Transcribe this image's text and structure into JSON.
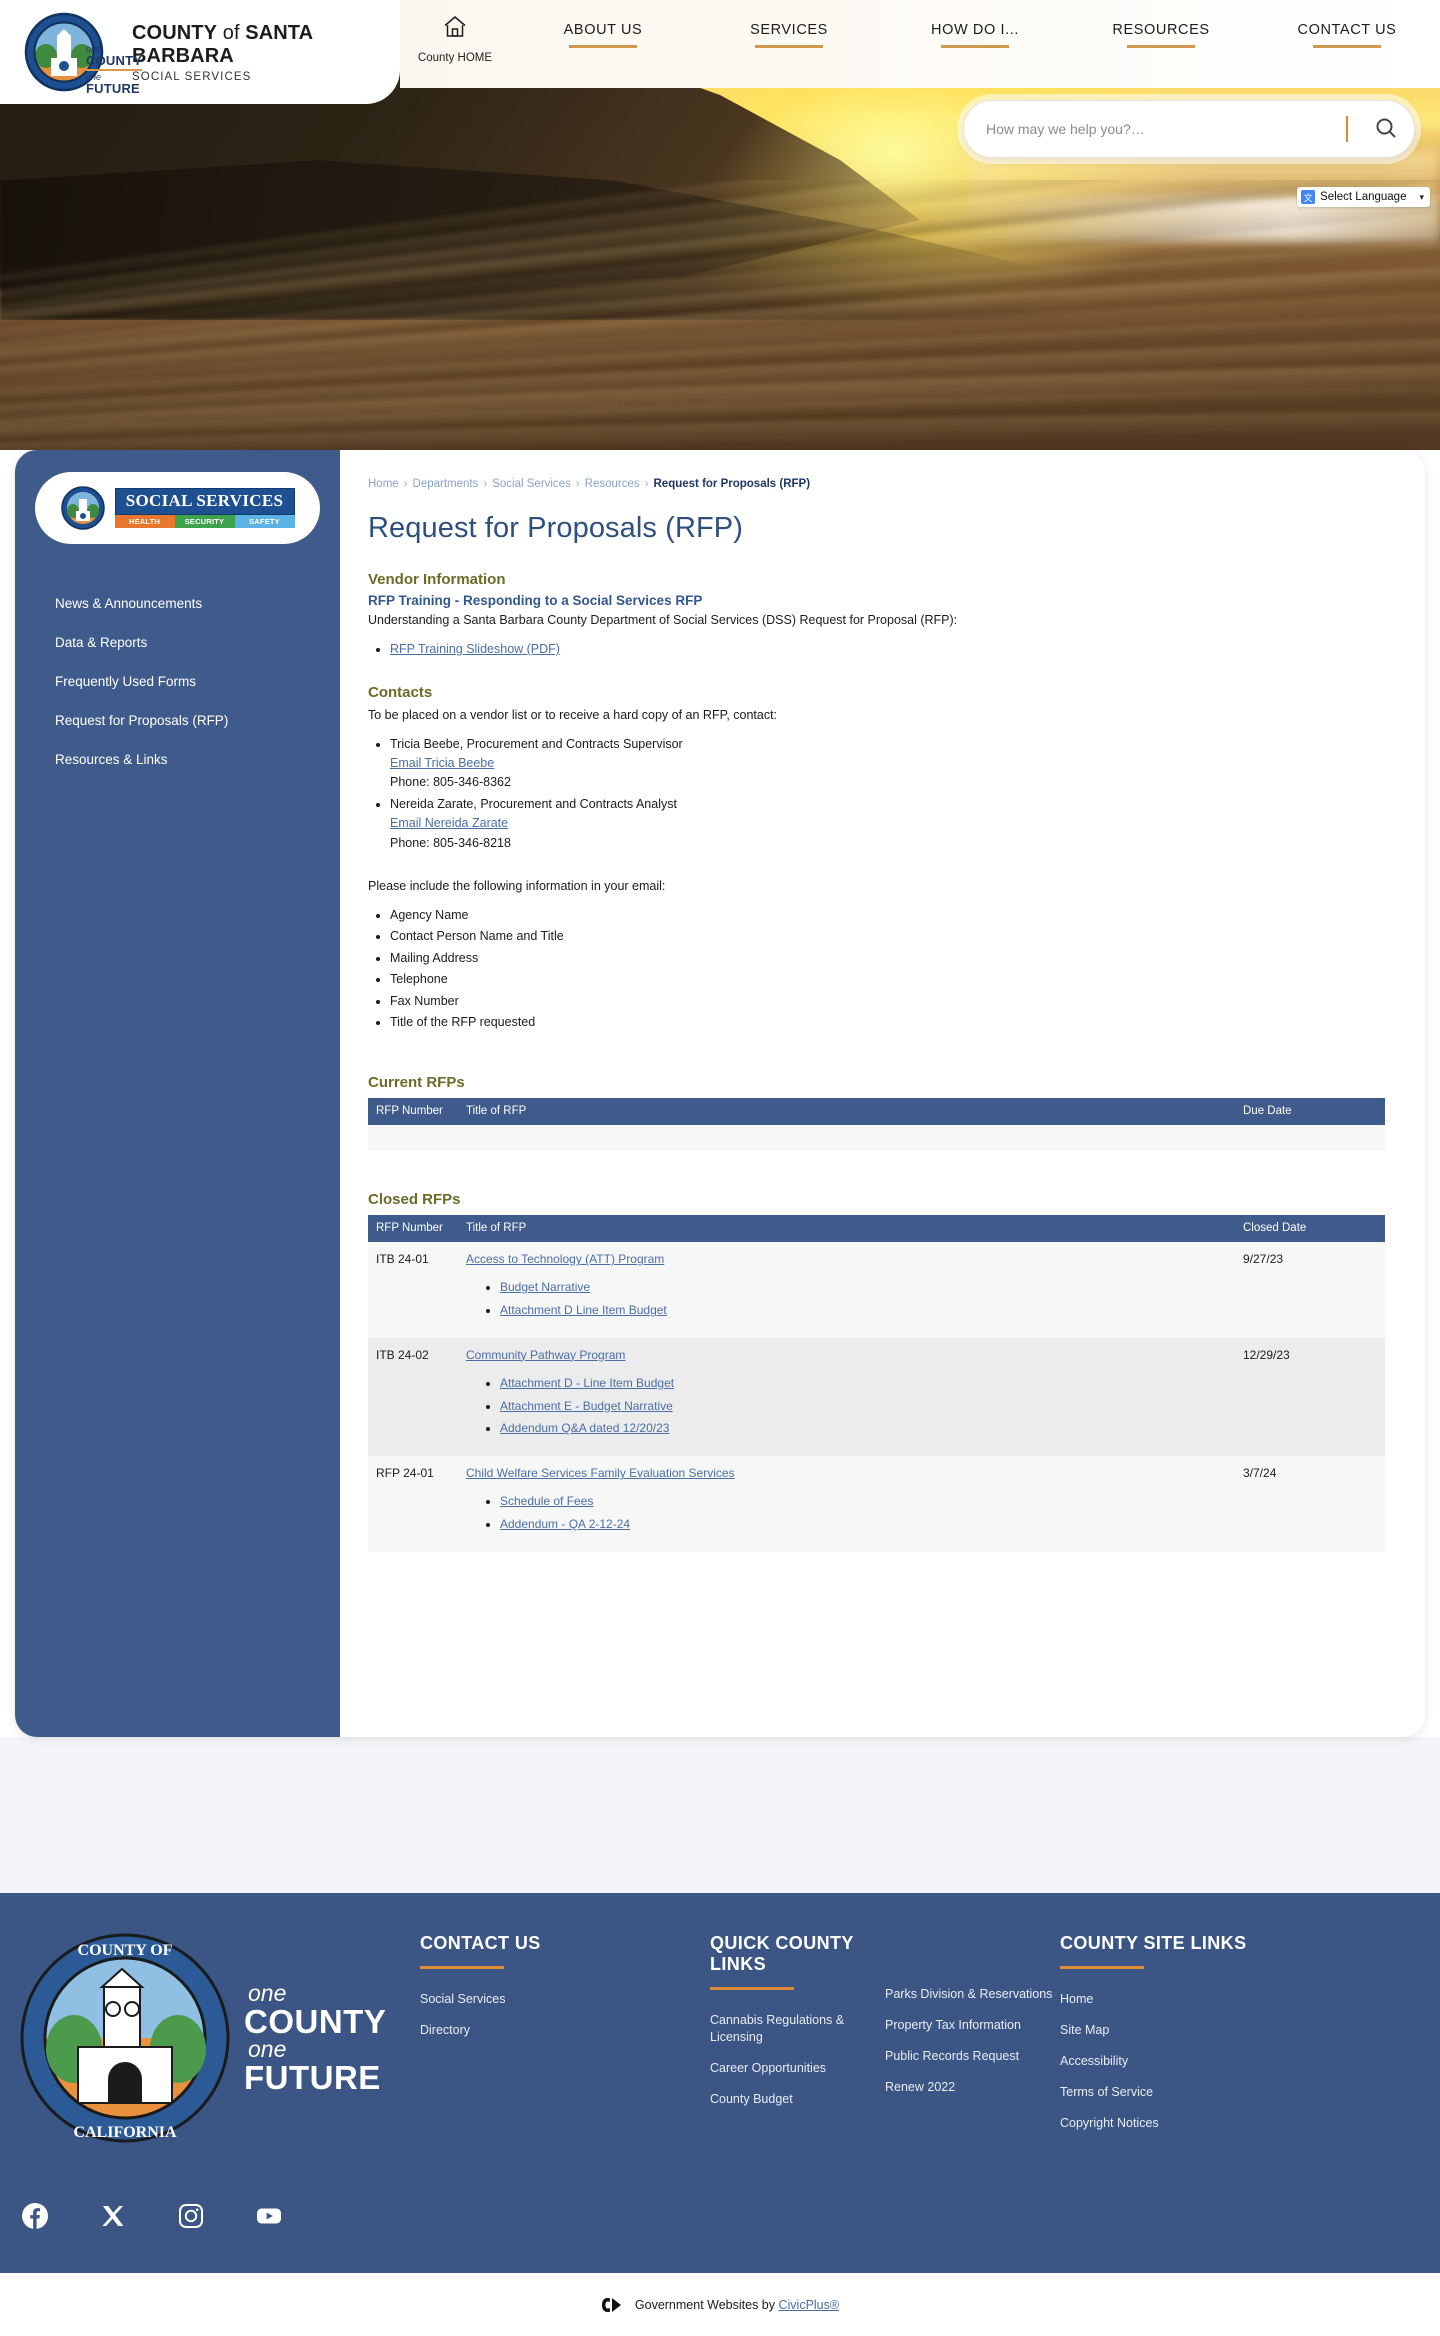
{
  "header": {
    "brand": {
      "line1_pre": "COUNTY",
      "line1_of": "of",
      "line1_post": "SANTA BARBARA",
      "line2": "SOCIAL SERVICES",
      "tag_one1": "one",
      "tag_county": "COUNTY",
      "tag_one2": "one",
      "tag_future": "FUTURE"
    },
    "home_label": "County HOME",
    "nav": [
      {
        "label": "ABOUT US"
      },
      {
        "label": "SERVICES"
      },
      {
        "label": "HOW DO I..."
      },
      {
        "label": "RESOURCES"
      },
      {
        "label": "CONTACT US"
      }
    ],
    "search": {
      "placeholder": "How may we help you?…",
      "value": "",
      "icon": "search-icon"
    },
    "language": {
      "label": "Select Language",
      "icon": "google-translate-icon"
    }
  },
  "sidebar": {
    "logo": {
      "title": "SOCIAL SERVICES",
      "pills": [
        "HEALTH",
        "SECURITY",
        "SAFETY"
      ]
    },
    "items": [
      {
        "label": "News & Announcements"
      },
      {
        "label": "Data & Reports"
      },
      {
        "label": "Frequently Used Forms"
      },
      {
        "label": "Request for Proposals (RFP)"
      },
      {
        "label": "Resources & Links"
      }
    ]
  },
  "breadcrumb": {
    "items": [
      "Home",
      "Departments",
      "Social Services",
      "Resources"
    ],
    "current": "Request for Proposals (RFP)"
  },
  "main": {
    "title": "Request for Proposals (RFP)",
    "vendor_heading": "Vendor Information",
    "training_heading": "RFP Training - Responding to a Social Services RFP",
    "training_text": "Understanding a Santa Barbara County Department of Social Services (DSS) Request for Proposal (RFP):",
    "training_link": "RFP Training Slideshow (PDF)",
    "contacts_heading": "Contacts",
    "contacts_intro": "To be placed on a vendor list or to receive a hard copy of an RFP, contact:",
    "contacts": [
      {
        "name": "Tricia Beebe, Procurement and Contracts Supervisor",
        "email_link": "Email Tricia Beebe",
        "phone": "Phone: 805-346-8362"
      },
      {
        "name": "Nereida Zarate, Procurement and Contracts Analyst",
        "email_link": "Email Nereida Zarate",
        "phone": "Phone: 805-346-8218"
      }
    ],
    "include_intro": "Please include the following information in your email:",
    "include_items": [
      "Agency Name",
      "Contact Person Name and Title",
      "Mailing Address",
      "Telephone",
      "Fax Number",
      "Title of the RFP requested"
    ],
    "current_rfps": {
      "title": "Current RFPs",
      "columns": [
        "RFP Number",
        "Title of RFP",
        "Due Date"
      ],
      "rows": []
    },
    "closed_rfps": {
      "title": "Closed RFPs",
      "columns": [
        "RFP Number",
        "Title of RFP",
        "Closed Date"
      ],
      "rows": [
        {
          "number": "ITB 24-01",
          "title": "Access to Technology (ATT) Program",
          "attachments": [
            "Budget Narrative",
            "Attachment D Line Item Budget"
          ],
          "date": "9/27/23"
        },
        {
          "number": "ITB 24-02",
          "title": "Community Pathway Program",
          "attachments": [
            "Attachment D - Line Item Budget",
            "Attachment E - Budget Narrative",
            "Addendum Q&A dated 12/20/23"
          ],
          "date": "12/29/23"
        },
        {
          "number": "RFP 24-01",
          "title": "Child Welfare Services Family Evaluation Services",
          "attachments": [
            "Schedule of Fees",
            "Addendum - QA 2-12-24"
          ],
          "date": "3/7/24"
        }
      ]
    }
  },
  "footer": {
    "tagline": {
      "one1": "one",
      "county": "COUNTY",
      "one2": "one",
      "future": "FUTURE"
    },
    "columns": [
      {
        "heading": "CONTACT US",
        "links": [
          "Social Services",
          "Directory"
        ]
      },
      {
        "heading": "QUICK COUNTY LINKS",
        "links_a": [
          "Cannabis Regulations & Licensing",
          "Career Opportunities",
          "County Budget"
        ],
        "links_b": [
          "Parks Division & Reservations",
          "Property Tax Information",
          "Public Records Request",
          "Renew 2022"
        ]
      },
      {
        "heading": "COUNTY SITE LINKS",
        "links": [
          "Home",
          "Site Map",
          "Accessibility",
          "Terms of Service",
          "Copyright Notices"
        ]
      }
    ],
    "socials": [
      "facebook-icon",
      "x-twitter-icon",
      "instagram-icon",
      "youtube-icon"
    ],
    "civic": {
      "prefix": "Government Websites by ",
      "link": "CivicPlus®"
    }
  },
  "colors": {
    "navy": "#3f5b8b",
    "footer_navy": "#3b5584",
    "accent_orange": "#e08b36",
    "nav_underline": "#cf9a4f",
    "link_blue": "#4a6fa5",
    "section_olive": "#6b6b2a",
    "title_blue": "#2f4f7f"
  }
}
